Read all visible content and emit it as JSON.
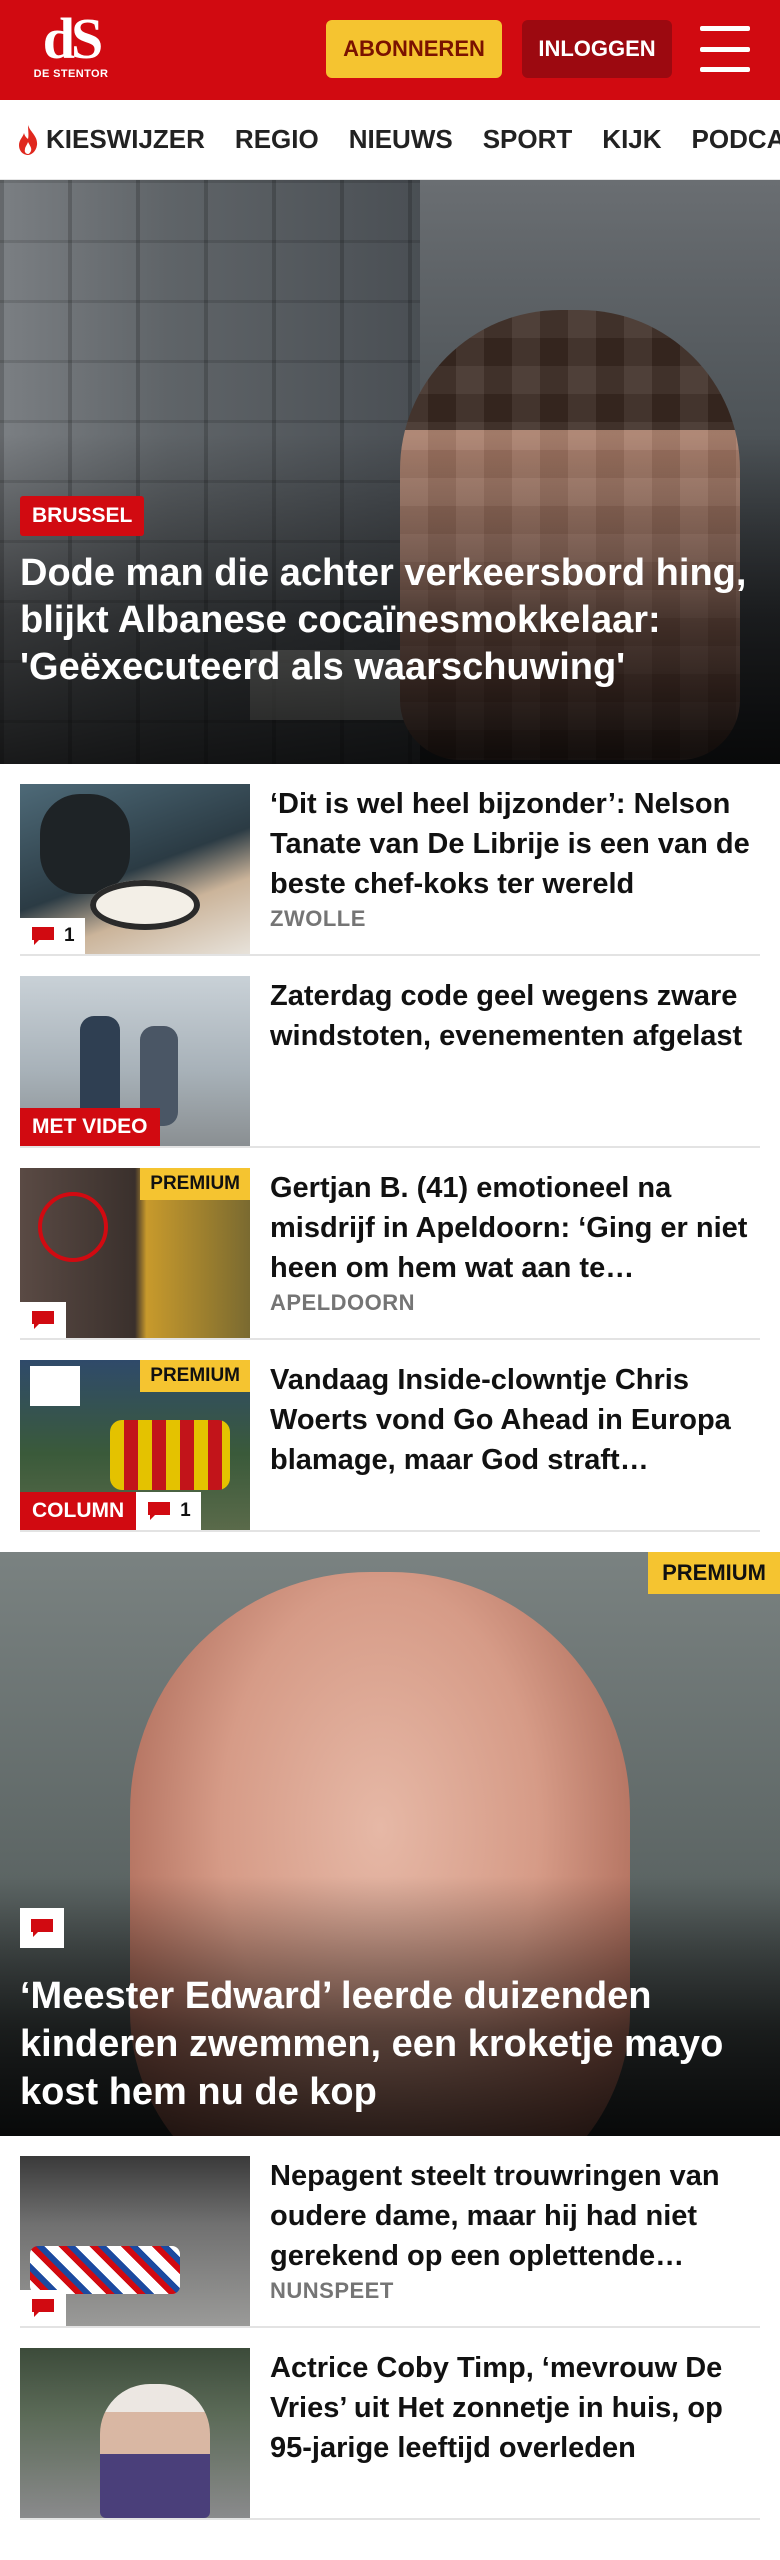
{
  "header": {
    "logo_mark": "dS",
    "logo_sub": "DE STENTOR",
    "subscribe_label": "ABONNEREN",
    "login_label": "INLOGGEN"
  },
  "nav": {
    "items": [
      "KIESWIJZER",
      "REGIO",
      "NIEUWS",
      "SPORT",
      "KIJK",
      "PODCAST"
    ]
  },
  "hero": {
    "label": "BRUSSEL",
    "title": "Dode man die achter verkeersbord hing, blijkt Albanese cocaïnesmokkelaar: 'Geëxecuteerd als waarschuwing'"
  },
  "articles_top": [
    {
      "title": "‘Dit is wel heel bijzonder’: Nelson Tanate van De Librije is een van de beste chef-koks ter wereld",
      "place": "ZWOLLE",
      "comments": "1"
    },
    {
      "title": "Zaterdag code geel wegens zware windstoten, evenementen afgelast",
      "badge": "MET VIDEO"
    },
    {
      "title": "Gertjan B. (41) emotioneel na misdrijf in Apeldoorn: ‘Ging er niet heen om hem wat aan te…",
      "place": "APELDOORN",
      "premium": "PREMIUM"
    },
    {
      "title": "Vandaag Inside-clowntje Chris Woerts vond Go Ahead in Europa blamage, maar God straft…",
      "premium": "PREMIUM",
      "badge": "COLUMN",
      "comments": "1"
    }
  ],
  "feature": {
    "premium": "PREMIUM",
    "title": "‘Meester Edward’ leerde duizenden kinderen zwemmen, een kroketje mayo kost hem nu de kop"
  },
  "articles_bottom": [
    {
      "title": "Nepagent steelt trouwringen van oudere dame, maar hij had niet gerekend op een oplettende…",
      "place": "NUNSPEET"
    },
    {
      "title": "Actrice Coby Timp, ‘mevrouw De Vries’ uit Het zonnetje in huis, op 95-jarige leeftijd overleden"
    }
  ],
  "colors": {
    "brand_red": "#d10a11",
    "premium_yellow": "#f5c430",
    "login_dark_red": "#9c0910"
  }
}
